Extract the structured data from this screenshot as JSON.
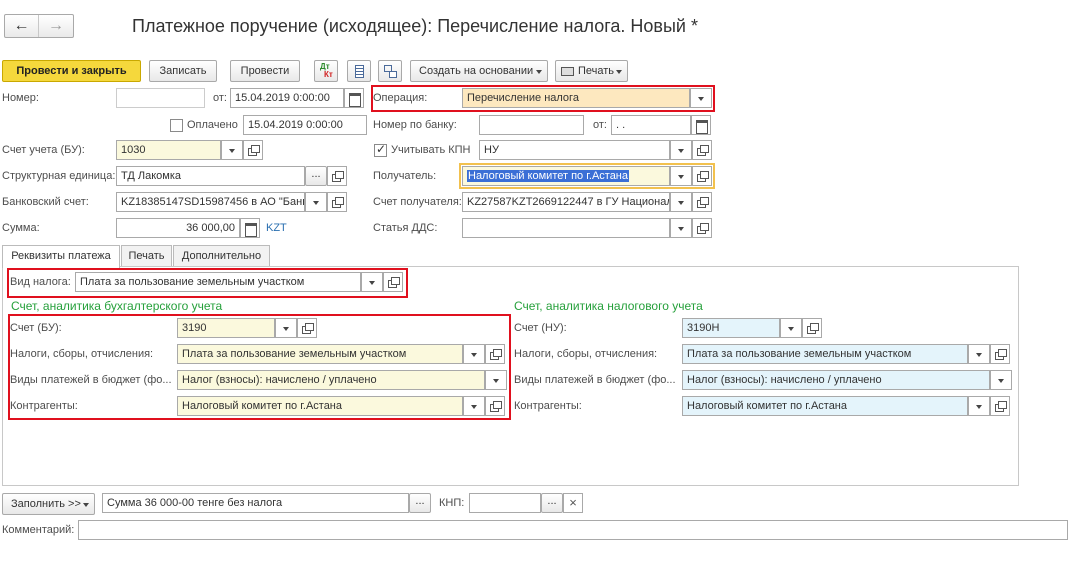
{
  "window": {
    "title": "Платежное поручение (исходящее): Перечисление налога. Новый *"
  },
  "nav": {
    "back": "back",
    "forward": "forward"
  },
  "toolbar": {
    "post_close": "Провести и закрыть",
    "save": "Записать",
    "post": "Провести",
    "dtkt_icon": "dt-kt-icon",
    "list_icon": "list-icon",
    "struct_icon": "structure-icon",
    "create_based": "Создать на основании",
    "print": "Печать"
  },
  "header": {
    "number_label": "Номер:",
    "number_value": "",
    "from_label": "от:",
    "date_value": "15.04.2019  0:00:00",
    "operation_label": "Операция:",
    "operation_value": "Перечисление налога",
    "paid_label": "Оплачено",
    "paid_date": "15.04.2019  0:00:00",
    "bank_no_label": "Номер по банку:",
    "bank_no_value": "",
    "bank_from_label": "от:",
    "bank_date": " .  .",
    "account_label": "Счет учета (БУ):",
    "account_value": "1030",
    "kpn_label": "Учитывать КПН",
    "kpn_value": "НУ",
    "unit_label": "Структурная единица:",
    "unit_value": "ТД Лакомка",
    "recipient_label": "Получатель:",
    "recipient_value": "Налоговый комитет по г.Астана",
    "bank_acc_label": "Банковский счет:",
    "bank_acc_value": "KZ18385147SD15987456 в АО \"Банк",
    "recipient_acc_label": "Счет получателя:",
    "recipient_acc_value": "KZ27587KZT2669122447 в ГУ Национал",
    "sum_label": "Сумма:",
    "sum_value": "36 000,00",
    "currency": "KZT",
    "dds_label": "Статья ДДС:",
    "dds_value": ""
  },
  "tabs": [
    {
      "label": "Реквизиты платежа"
    },
    {
      "label": "Печать"
    },
    {
      "label": "Дополнительно"
    }
  ],
  "details": {
    "tax_kind_label": "Вид налога:",
    "tax_kind_value": "Плата за пользование земельным участком",
    "bu_heading": "Счет, аналитика бухгалтерского учета",
    "nu_heading": "Счет, аналитика налогового учета",
    "bu": {
      "account_label": "Счет (БУ):",
      "account_value": "3190",
      "taxes_label": "Налоги, сборы, отчисления:",
      "taxes_value": "Плата за пользование земельным участком",
      "payments_label": "Виды платежей в бюджет (фо...",
      "payments_value": "Налог (взносы): начислено / уплачено",
      "contractors_label": "Контрагенты:",
      "contractors_value": "Налоговый комитет по г.Астана"
    },
    "nu": {
      "account_label": "Счет (НУ):",
      "account_value": "3190Н",
      "taxes_label": "Налоги, сборы, отчисления:",
      "taxes_value": "Плата за пользование земельным участком",
      "payments_label": "Виды платежей в бюджет (фо...",
      "payments_value": "Налог (взносы): начислено / уплачено",
      "contractors_label": "Контрагенты:",
      "contractors_value": "Налоговый комитет по г.Астана"
    }
  },
  "footer": {
    "fill_button": "Заполнить >>",
    "purpose_value": "Сумма 36 000-00  тенге  без налога",
    "knp_label": "КНП:",
    "knp_value": "",
    "comment_label": "Комментарий:",
    "comment_value": ""
  }
}
